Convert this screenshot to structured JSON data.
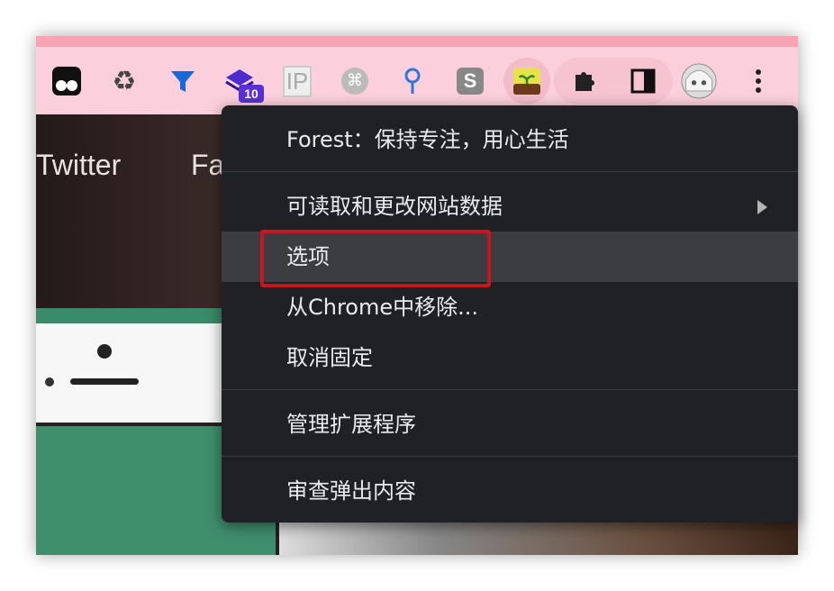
{
  "toolbar": {
    "extensions": [
      {
        "name": "tampermonkey"
      },
      {
        "name": "recycle"
      },
      {
        "name": "filter"
      },
      {
        "name": "stack",
        "badge": "10"
      },
      {
        "name": "ip",
        "label": "IP"
      },
      {
        "name": "command",
        "label": "⌘"
      },
      {
        "name": "location-pin"
      },
      {
        "name": "s-extension",
        "label": "S"
      },
      {
        "name": "forest"
      }
    ]
  },
  "page": {
    "hero_left": "Twitter",
    "hero_right": "Fa"
  },
  "menu": {
    "title": "Forest：保持专注，用心生活",
    "items": [
      {
        "label": "可读取和更改网站数据",
        "submenu": true
      },
      {
        "label": "选项",
        "highlighted": true
      },
      {
        "label": "从Chrome中移除..."
      },
      {
        "label": "取消固定"
      },
      {
        "label": "管理扩展程序"
      },
      {
        "label": "审查弹出内容"
      }
    ]
  },
  "colors": {
    "toolbar_bg": "#fbd0dc",
    "menu_bg": "#202124",
    "highlight_border": "#c4161c"
  }
}
